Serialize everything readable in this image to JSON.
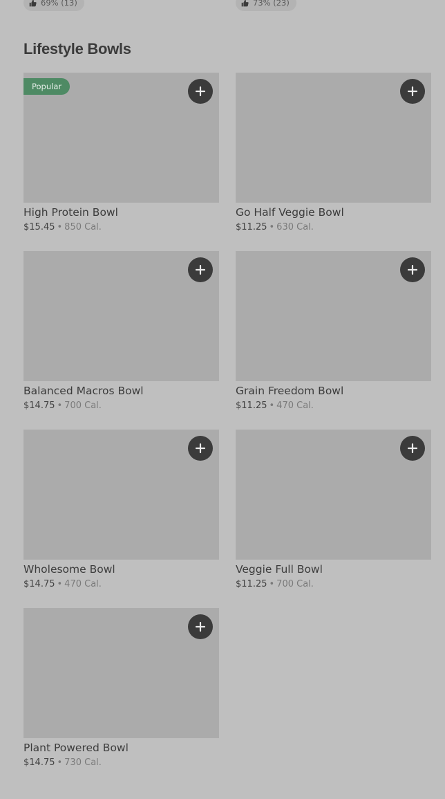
{
  "top_ratings": [
    {
      "label": "69% (13)"
    },
    {
      "label": "73% (23)"
    }
  ],
  "section": {
    "title": "Lifestyle Bowls"
  },
  "icons": {
    "rating": "thumbs-up-icon",
    "add": "plus-icon"
  },
  "colors": {
    "badge": "#4e8a64",
    "add_button": "#3b3b3b",
    "background": "#bfbfbf",
    "image_placeholder": "#ababab"
  },
  "items": [
    {
      "name": "High Protein Bowl",
      "price": "$15.45",
      "separator": "•",
      "calories": "850 Cal.",
      "badge": "Popular"
    },
    {
      "name": "Go Half Veggie Bowl",
      "price": "$11.25",
      "separator": "•",
      "calories": "630 Cal.",
      "badge": ""
    },
    {
      "name": "Balanced Macros Bowl",
      "price": "$14.75",
      "separator": "•",
      "calories": "700 Cal.",
      "badge": ""
    },
    {
      "name": "Grain Freedom Bowl",
      "price": "$11.25",
      "separator": "•",
      "calories": "470 Cal.",
      "badge": ""
    },
    {
      "name": "Wholesome Bowl",
      "price": "$14.75",
      "separator": "•",
      "calories": "470 Cal.",
      "badge": ""
    },
    {
      "name": "Veggie Full Bowl",
      "price": "$11.25",
      "separator": "•",
      "calories": "700 Cal.",
      "badge": ""
    },
    {
      "name": "Plant Powered Bowl",
      "price": "$14.75",
      "separator": "•",
      "calories": "730 Cal.",
      "badge": ""
    }
  ]
}
